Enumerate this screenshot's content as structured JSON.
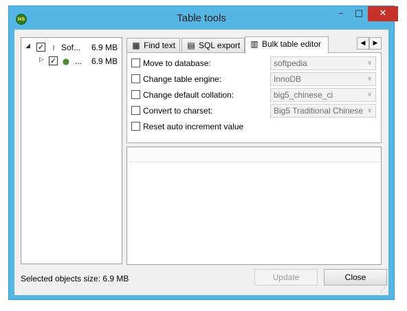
{
  "window": {
    "title": "Table tools",
    "app_icon": "heidisql-logo-icon",
    "app_icon_text": "HS",
    "controls": {
      "minimize": "minimize-icon",
      "maximize": "maximize-icon",
      "close": "close-icon"
    }
  },
  "tree": {
    "items": [
      {
        "label": "Sof...",
        "size": "6.9 MB",
        "checked": true,
        "expanded": true,
        "icon": "server-connection-icon"
      },
      {
        "label": "...",
        "size": "6.9 MB",
        "checked": true,
        "expanded": false,
        "icon": "database-icon"
      }
    ]
  },
  "tabs": [
    {
      "label": "Find text",
      "icon": "find-icon",
      "active": false
    },
    {
      "label": "SQL export",
      "icon": "sql-export-icon",
      "active": false
    },
    {
      "label": "Bulk table editor",
      "icon": "bulk-edit-icon",
      "active": true
    }
  ],
  "tab_scroll": {
    "left": "scroll-left-icon",
    "right": "scroll-right-icon"
  },
  "bulk_editor": {
    "options": [
      {
        "label": "Move to database:",
        "checked": false,
        "select_value": "softpedia"
      },
      {
        "label": "Change table engine:",
        "checked": false,
        "select_value": "InnoDB"
      },
      {
        "label": "Change default collation:",
        "checked": false,
        "select_value": "big5_chinese_ci"
      },
      {
        "label": "Convert to charset:",
        "checked": false,
        "select_value": "Big5 Traditional Chinese"
      },
      {
        "label": "Reset auto increment value",
        "checked": false
      }
    ]
  },
  "footer": {
    "status": "Selected objects size: 6.9 MB",
    "update_label": "Update",
    "close_label": "Close"
  },
  "colors": {
    "title_bar": "#56b6e3",
    "close_button": "#c7312a",
    "disabled_text": "#9c9c9c"
  }
}
